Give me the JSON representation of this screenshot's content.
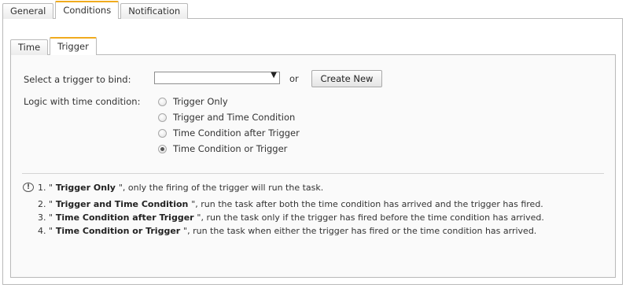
{
  "outer_tabs": [
    "General",
    "Conditions",
    "Notification"
  ],
  "outer_active": "Conditions",
  "inner_tabs": [
    "Time",
    "Trigger"
  ],
  "inner_active": "Trigger",
  "trigger": {
    "label": "Select a trigger to bind:",
    "selected": "",
    "or_text": "or",
    "create_button": "Create New"
  },
  "logic": {
    "label": "Logic with time condition:",
    "options": [
      "Trigger Only",
      "Trigger and Time Condition",
      "Time Condition after Trigger",
      "Time Condition or Trigger"
    ],
    "selected_index": 3
  },
  "notes": [
    {
      "num": "1.",
      "pre": " \"",
      "bold": " Trigger Only ",
      "post": "\", only the firing of the trigger will run the task."
    },
    {
      "num": "2.",
      "pre": " \"",
      "bold": " Trigger and Time Condition ",
      "post": "\", run the task after both the time condition has arrived and the trigger has fired."
    },
    {
      "num": "3.",
      "pre": " \"",
      "bold": " Time Condition after Trigger ",
      "post": "\", run the task only if the trigger has fired before the time condition has arrived."
    },
    {
      "num": "4.",
      "pre": " \"",
      "bold": " Time Condition or Trigger ",
      "post": "\", run the task when either the trigger has fired or the time condition has arrived."
    }
  ],
  "icons": {
    "info": "info-icon",
    "dropdown": "chevron-down-icon"
  }
}
